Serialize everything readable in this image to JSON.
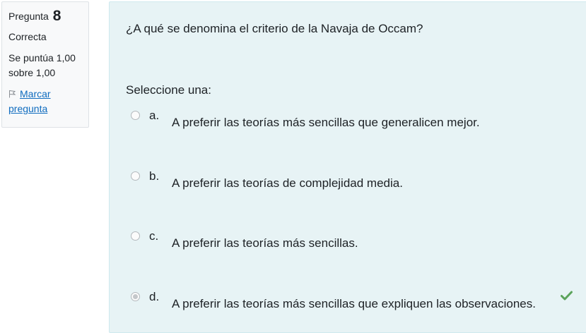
{
  "question_info": {
    "label": "Pregunta",
    "number": "8",
    "state": "Correcta",
    "grade": "Se puntúa 1,00 sobre 1,00",
    "flag_label": "Marcar pregunta"
  },
  "question": {
    "text": "¿A qué se denomina el criterio de la Navaja de Occam?",
    "prompt": "Seleccione una:",
    "options": [
      {
        "letter": "a.",
        "text": "A preferir las teorías más sencillas que generalicen mejor.",
        "selected": false
      },
      {
        "letter": "b.",
        "text": "A preferir las teorías de complejidad media.",
        "selected": false
      },
      {
        "letter": "c.",
        "text": "A preferir las teorías más sencillas.",
        "selected": false
      },
      {
        "letter": "d.",
        "text": "A preferir las teorías más sencillas que expliquen las observaciones.",
        "selected": true,
        "correct": true
      }
    ]
  },
  "colors": {
    "content_background": "#e7f3f5",
    "info_background": "#f8f9fa",
    "link": "#0f6cbf",
    "correct_check": "#5ba35b"
  },
  "icons": {
    "flag": "flag-icon",
    "correct": "check-icon"
  }
}
